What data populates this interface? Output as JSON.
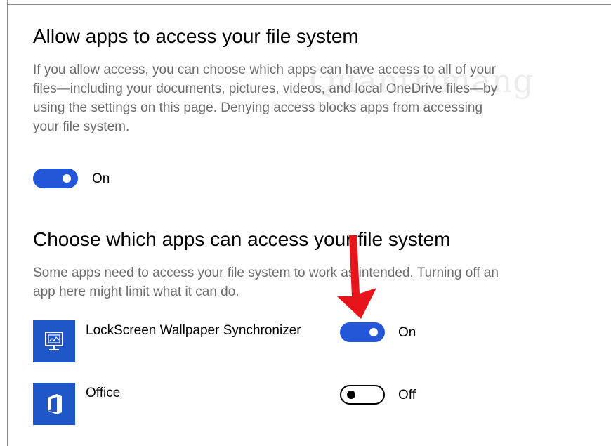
{
  "section1": {
    "title": "Allow apps to access your file system",
    "description": "If you allow access, you can choose which apps can have access to all of your files—including your documents, pictures, videos, and local OneDrive files—by using the settings on this page. Denying access blocks apps from accessing your file system.",
    "toggle": {
      "state": "on",
      "label": "On"
    }
  },
  "section2": {
    "title": "Choose which apps can access your file system",
    "description": "Some apps need to access your file system to work as intended. Turning off an app here might limit what it can do.",
    "apps": [
      {
        "name": "LockScreen Wallpaper Synchronizer",
        "icon": "monitor-icon",
        "toggle": {
          "state": "on",
          "label": "On"
        }
      },
      {
        "name": "Office",
        "icon": "office-logo-icon",
        "toggle": {
          "state": "off",
          "label": "Off"
        }
      }
    ]
  },
  "watermark": "Quantrimang",
  "colors": {
    "accent": "#2456d8",
    "tile": "#1f57c8",
    "arrow": "#e8141b",
    "description": "#6b6b6b"
  }
}
